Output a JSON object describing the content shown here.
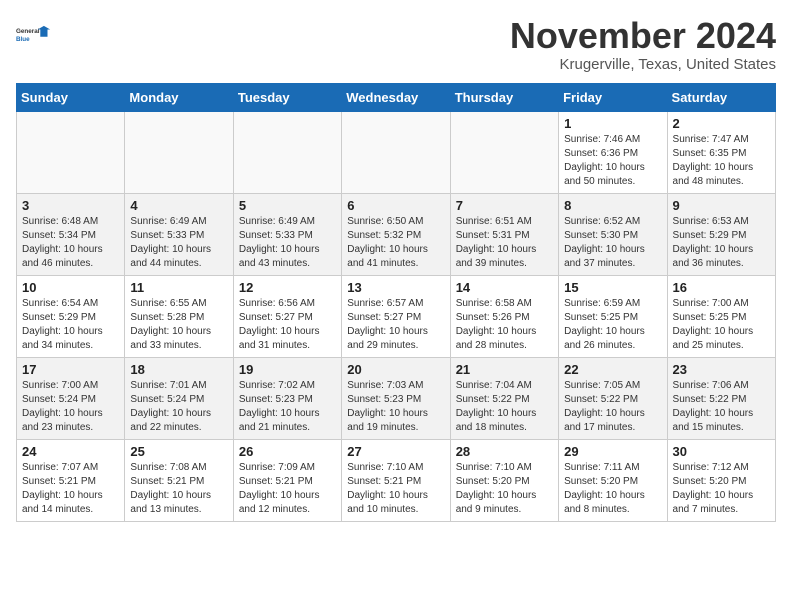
{
  "header": {
    "logo_line1": "General",
    "logo_line2": "Blue",
    "month": "November 2024",
    "location": "Krugerville, Texas, United States"
  },
  "weekdays": [
    "Sunday",
    "Monday",
    "Tuesday",
    "Wednesday",
    "Thursday",
    "Friday",
    "Saturday"
  ],
  "weeks": [
    [
      {
        "day": "",
        "info": ""
      },
      {
        "day": "",
        "info": ""
      },
      {
        "day": "",
        "info": ""
      },
      {
        "day": "",
        "info": ""
      },
      {
        "day": "",
        "info": ""
      },
      {
        "day": "1",
        "info": "Sunrise: 7:46 AM\nSunset: 6:36 PM\nDaylight: 10 hours\nand 50 minutes."
      },
      {
        "day": "2",
        "info": "Sunrise: 7:47 AM\nSunset: 6:35 PM\nDaylight: 10 hours\nand 48 minutes."
      }
    ],
    [
      {
        "day": "3",
        "info": "Sunrise: 6:48 AM\nSunset: 5:34 PM\nDaylight: 10 hours\nand 46 minutes."
      },
      {
        "day": "4",
        "info": "Sunrise: 6:49 AM\nSunset: 5:33 PM\nDaylight: 10 hours\nand 44 minutes."
      },
      {
        "day": "5",
        "info": "Sunrise: 6:49 AM\nSunset: 5:33 PM\nDaylight: 10 hours\nand 43 minutes."
      },
      {
        "day": "6",
        "info": "Sunrise: 6:50 AM\nSunset: 5:32 PM\nDaylight: 10 hours\nand 41 minutes."
      },
      {
        "day": "7",
        "info": "Sunrise: 6:51 AM\nSunset: 5:31 PM\nDaylight: 10 hours\nand 39 minutes."
      },
      {
        "day": "8",
        "info": "Sunrise: 6:52 AM\nSunset: 5:30 PM\nDaylight: 10 hours\nand 37 minutes."
      },
      {
        "day": "9",
        "info": "Sunrise: 6:53 AM\nSunset: 5:29 PM\nDaylight: 10 hours\nand 36 minutes."
      }
    ],
    [
      {
        "day": "10",
        "info": "Sunrise: 6:54 AM\nSunset: 5:29 PM\nDaylight: 10 hours\nand 34 minutes."
      },
      {
        "day": "11",
        "info": "Sunrise: 6:55 AM\nSunset: 5:28 PM\nDaylight: 10 hours\nand 33 minutes."
      },
      {
        "day": "12",
        "info": "Sunrise: 6:56 AM\nSunset: 5:27 PM\nDaylight: 10 hours\nand 31 minutes."
      },
      {
        "day": "13",
        "info": "Sunrise: 6:57 AM\nSunset: 5:27 PM\nDaylight: 10 hours\nand 29 minutes."
      },
      {
        "day": "14",
        "info": "Sunrise: 6:58 AM\nSunset: 5:26 PM\nDaylight: 10 hours\nand 28 minutes."
      },
      {
        "day": "15",
        "info": "Sunrise: 6:59 AM\nSunset: 5:25 PM\nDaylight: 10 hours\nand 26 minutes."
      },
      {
        "day": "16",
        "info": "Sunrise: 7:00 AM\nSunset: 5:25 PM\nDaylight: 10 hours\nand 25 minutes."
      }
    ],
    [
      {
        "day": "17",
        "info": "Sunrise: 7:00 AM\nSunset: 5:24 PM\nDaylight: 10 hours\nand 23 minutes."
      },
      {
        "day": "18",
        "info": "Sunrise: 7:01 AM\nSunset: 5:24 PM\nDaylight: 10 hours\nand 22 minutes."
      },
      {
        "day": "19",
        "info": "Sunrise: 7:02 AM\nSunset: 5:23 PM\nDaylight: 10 hours\nand 21 minutes."
      },
      {
        "day": "20",
        "info": "Sunrise: 7:03 AM\nSunset: 5:23 PM\nDaylight: 10 hours\nand 19 minutes."
      },
      {
        "day": "21",
        "info": "Sunrise: 7:04 AM\nSunset: 5:22 PM\nDaylight: 10 hours\nand 18 minutes."
      },
      {
        "day": "22",
        "info": "Sunrise: 7:05 AM\nSunset: 5:22 PM\nDaylight: 10 hours\nand 17 minutes."
      },
      {
        "day": "23",
        "info": "Sunrise: 7:06 AM\nSunset: 5:22 PM\nDaylight: 10 hours\nand 15 minutes."
      }
    ],
    [
      {
        "day": "24",
        "info": "Sunrise: 7:07 AM\nSunset: 5:21 PM\nDaylight: 10 hours\nand 14 minutes."
      },
      {
        "day": "25",
        "info": "Sunrise: 7:08 AM\nSunset: 5:21 PM\nDaylight: 10 hours\nand 13 minutes."
      },
      {
        "day": "26",
        "info": "Sunrise: 7:09 AM\nSunset: 5:21 PM\nDaylight: 10 hours\nand 12 minutes."
      },
      {
        "day": "27",
        "info": "Sunrise: 7:10 AM\nSunset: 5:21 PM\nDaylight: 10 hours\nand 10 minutes."
      },
      {
        "day": "28",
        "info": "Sunrise: 7:10 AM\nSunset: 5:20 PM\nDaylight: 10 hours\nand 9 minutes."
      },
      {
        "day": "29",
        "info": "Sunrise: 7:11 AM\nSunset: 5:20 PM\nDaylight: 10 hours\nand 8 minutes."
      },
      {
        "day": "30",
        "info": "Sunrise: 7:12 AM\nSunset: 5:20 PM\nDaylight: 10 hours\nand 7 minutes."
      }
    ]
  ]
}
